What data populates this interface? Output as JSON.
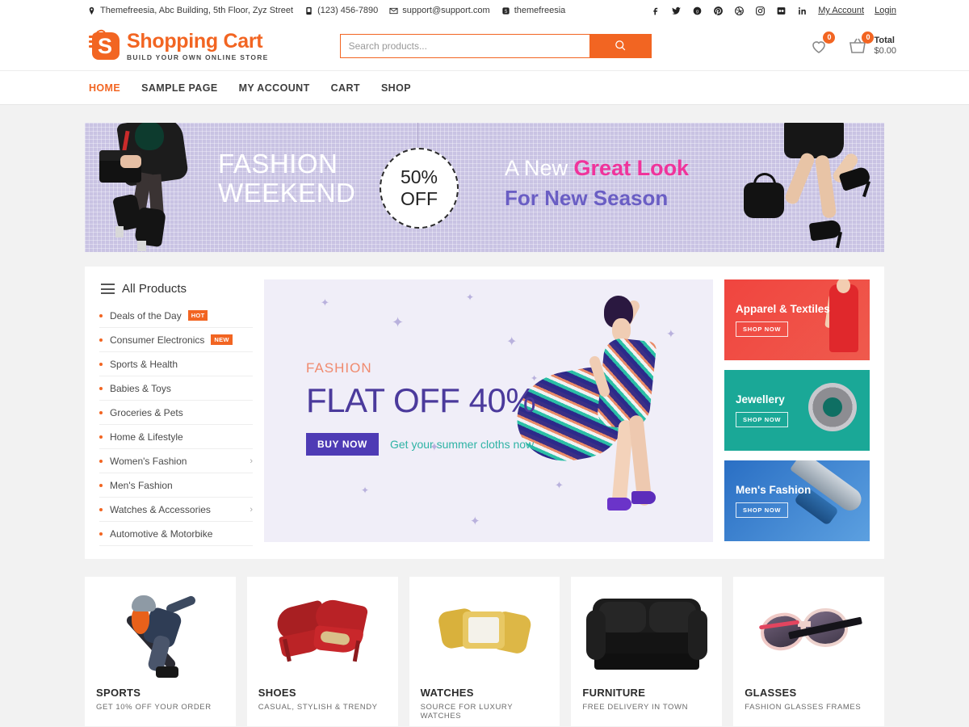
{
  "topbar": {
    "address": "Themefreesia, Abc Building, 5th Floor, Zyz Street",
    "phone": "(123) 456-7890",
    "email": "support@support.com",
    "skype": "themefreesia",
    "social": [
      {
        "name": "facebook-icon",
        "label": "f"
      },
      {
        "name": "twitter-icon",
        "label": "t"
      },
      {
        "name": "google-plus-icon",
        "label": "g+"
      },
      {
        "name": "pinterest-icon",
        "label": "p"
      },
      {
        "name": "dribbble-icon",
        "label": "d"
      },
      {
        "name": "instagram-icon",
        "label": "ig"
      },
      {
        "name": "flickr-icon",
        "label": "fl"
      },
      {
        "name": "linkedin-icon",
        "label": "in"
      }
    ],
    "my_account": "My Account",
    "login": "Login"
  },
  "header": {
    "logo_title": "Shopping Cart",
    "logo_sub": "BUILD YOUR OWN ONLINE STORE",
    "logo_letter": "S",
    "search_placeholder": "Search products...",
    "search_value": "",
    "wishlist_count": "0",
    "cart_count": "0",
    "total_label": "Total",
    "total_value": "$0.00"
  },
  "nav": {
    "items": [
      {
        "label": "HOME",
        "active": true
      },
      {
        "label": "SAMPLE PAGE",
        "active": false
      },
      {
        "label": "MY ACCOUNT",
        "active": false
      },
      {
        "label": "CART",
        "active": false
      },
      {
        "label": "SHOP",
        "active": false
      }
    ]
  },
  "hero": {
    "line1": "FASHION",
    "line2": "WEEKEND",
    "badge_pct": "50%",
    "badge_off": "OFF",
    "right_pre": "A New ",
    "right_hl": "Great Look",
    "right_line2": "For New Season"
  },
  "sidebar": {
    "title": "All Products",
    "items": [
      {
        "label": "Deals of the Day",
        "tag": "HOT",
        "chevron": false
      },
      {
        "label": "Consumer Electronics",
        "tag": "NEW",
        "chevron": false
      },
      {
        "label": "Sports & Health",
        "tag": "",
        "chevron": false
      },
      {
        "label": "Babies & Toys",
        "tag": "",
        "chevron": false
      },
      {
        "label": "Groceries & Pets",
        "tag": "",
        "chevron": false
      },
      {
        "label": "Home & Lifestyle",
        "tag": "",
        "chevron": false
      },
      {
        "label": "Women's Fashion",
        "tag": "",
        "chevron": true
      },
      {
        "label": "Men's Fashion",
        "tag": "",
        "chevron": false
      },
      {
        "label": "Watches & Accessories",
        "tag": "",
        "chevron": true
      },
      {
        "label": "Automotive & Motorbike",
        "tag": "",
        "chevron": false
      }
    ]
  },
  "promo": {
    "kicker": "FASHION",
    "headline": "FLAT OFF 40%",
    "button": "BUY NOW",
    "subtext": "Get your summer cloths now"
  },
  "promo_cards": [
    {
      "title": "Apparel & Textiles",
      "button": "SHOP NOW",
      "color": "#f0453f"
    },
    {
      "title": "Jewellery",
      "button": "SHOP NOW",
      "color": "#1aa897"
    },
    {
      "title": "Men's Fashion",
      "button": "SHOP NOW",
      "color": "#2a6fc4"
    }
  ],
  "categories": [
    {
      "title": "SPORTS",
      "sub": "GET 10% OFF YOUR ORDER"
    },
    {
      "title": "SHOES",
      "sub": "CASUAL, STYLISH & TRENDY"
    },
    {
      "title": "WATCHES",
      "sub": "SOURCE FOR LUXURY WATCHES"
    },
    {
      "title": "FURNITURE",
      "sub": "FREE DELIVERY IN TOWN"
    },
    {
      "title": "GLASSES",
      "sub": "FASHION GLASSES FRAMES"
    }
  ],
  "colors": {
    "brand_orange": "#f26522",
    "hero_bg": "#c9c3e3",
    "promo_purple": "#4b3a9c",
    "teal": "#2fb3a5"
  }
}
